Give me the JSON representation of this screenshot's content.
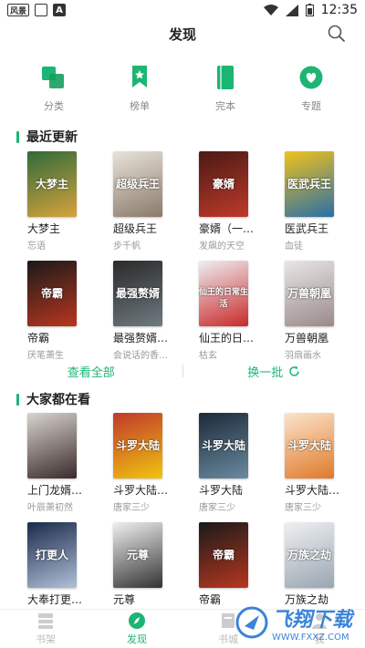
{
  "status": {
    "badge": "风景",
    "a": "A",
    "time": "12:35"
  },
  "header": {
    "title": "发现"
  },
  "categories": [
    {
      "label": "分类",
      "icon": "category-icon"
    },
    {
      "label": "榜单",
      "icon": "ranking-icon"
    },
    {
      "label": "完本",
      "icon": "completed-book-icon"
    },
    {
      "label": "专题",
      "icon": "topic-heart-icon"
    }
  ],
  "recent": {
    "title": "最近更新",
    "books": [
      {
        "title": "大梦主",
        "author": "忘语",
        "cover_text": "大梦主",
        "c1": "#2f6b3a",
        "c2": "#d8a23c"
      },
      {
        "title": "超级兵王",
        "author": "步千帆",
        "cover_text": "超级兵王",
        "c1": "#e9e3da",
        "c2": "#8a7a6a"
      },
      {
        "title": "豪婿（一…",
        "author": "发飙的天空",
        "cover_text": "豪婿",
        "c1": "#4a1a14",
        "c2": "#c0392b"
      },
      {
        "title": "医武兵王",
        "author": "血徒",
        "cover_text": "医武兵王",
        "c1": "#f0c21a",
        "c2": "#2a6fa8"
      },
      {
        "title": "帝霸",
        "author": "厌笔萧生",
        "cover_text": "帝霸",
        "c1": "#1a1a1a",
        "c2": "#b8361f"
      },
      {
        "title": "最强赘婿…",
        "author": "会说话的香…",
        "cover_text": "最强赘婿",
        "c1": "#2a2a2a",
        "c2": "#6e7a80"
      },
      {
        "title": "仙王的日…",
        "author": "枯玄",
        "cover_text": "仙王的日常生活",
        "c1": "#eeeef2",
        "c2": "#c92a2a"
      },
      {
        "title": "万兽朝凰",
        "author": "羽扇画水",
        "cover_text": "万兽朝凰",
        "c1": "#e8e6e6",
        "c2": "#9a8a8a"
      }
    ]
  },
  "actions": {
    "view_all": "查看全部",
    "refresh": "换一批"
  },
  "popular": {
    "title": "大家都在看",
    "books": [
      {
        "title": "上门龙婿…",
        "author": "叶辰萧初然",
        "cover_text": "",
        "c1": "#d8d4d0",
        "c2": "#3a2a2a"
      },
      {
        "title": "斗罗大陆…",
        "author": "唐家三少",
        "cover_text": "斗罗大陆",
        "c1": "#c0392b",
        "c2": "#f1c40f"
      },
      {
        "title": "斗罗大陆",
        "author": "唐家三少",
        "cover_text": "斗罗大陆",
        "c1": "#1c2a38",
        "c2": "#6a8aa0"
      },
      {
        "title": "斗罗大陆…",
        "author": "唐家三少",
        "cover_text": "斗罗大陆",
        "c1": "#fbe4cc",
        "c2": "#e07a2a"
      },
      {
        "title": "大奉打更…",
        "author": "",
        "cover_text": "打更人",
        "c1": "#1a2a4a",
        "c2": "#b0c0d8"
      },
      {
        "title": "元尊",
        "author": "",
        "cover_text": "元尊",
        "c1": "#f0f0f0",
        "c2": "#333333"
      },
      {
        "title": "帝霸",
        "author": "",
        "cover_text": "帝霸",
        "c1": "#1a1a1a",
        "c2": "#b8361f"
      },
      {
        "title": "万族之劫",
        "author": "",
        "cover_text": "万族之劫",
        "c1": "#eef0f2",
        "c2": "#9aa6b2"
      }
    ]
  },
  "bottomnav": [
    {
      "label": "书架",
      "icon": "bookshelf-icon",
      "active": false
    },
    {
      "label": "发现",
      "icon": "compass-icon",
      "active": true
    },
    {
      "label": "书城",
      "icon": "bookstore-icon",
      "active": false
    },
    {
      "label": "我",
      "icon": "profile-icon",
      "active": false
    }
  ],
  "watermark": {
    "text": "飞翔下载",
    "url": "WWW.FXXZ.COM"
  },
  "colors": {
    "accent": "#1db573"
  }
}
